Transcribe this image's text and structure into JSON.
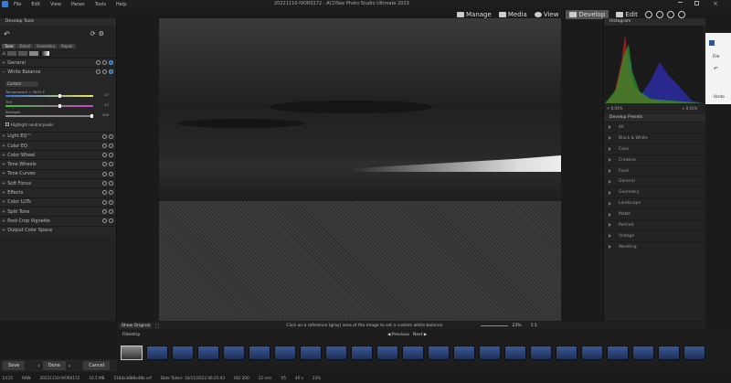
{
  "window": {
    "title": "20221110-IVOR0172 - ACDSee Photo Studio Ultimate 2023"
  },
  "menu": [
    "File",
    "Edit",
    "View",
    "Panes",
    "Tools",
    "Help"
  ],
  "modes": [
    {
      "label": "Manage"
    },
    {
      "label": "Media"
    },
    {
      "label": "View"
    },
    {
      "label": "Develop",
      "active": true
    },
    {
      "label": "Edit"
    }
  ],
  "develop_tools": {
    "title": "Develop Tools",
    "tabs": [
      "Tune",
      "Detail",
      "Geometry",
      "Repair"
    ],
    "white_balance": {
      "label": "White Balance",
      "preset": "Custom",
      "temperature_label": "Temperature = 5623 K",
      "temperature_value": "27",
      "tint_label": "Tint",
      "tint_value": "27",
      "strength_label": "Strength",
      "strength_value": "100",
      "highlight_label": "Highlight neutral pixels"
    },
    "sections": [
      "Light EQ™",
      "Color EQ",
      "Color Wheel",
      "Tone Wheels",
      "Tone Curves",
      "Soft Focus",
      "Effects",
      "Color LUTs",
      "Split Tone",
      "Post-Crop Vignette",
      "Output Color Space"
    ],
    "general_label": "General"
  },
  "histogram": {
    "title": "Histogram",
    "left_val": "< 0.01%",
    "right_val": "< 0.01%"
  },
  "develop_presets": {
    "title": "Develop Presets",
    "items": [
      "All",
      "Black & White",
      "Color",
      "Creative",
      "Food",
      "General",
      "Geometry",
      "Landscape",
      "Matte",
      "Portrait",
      "Vintage",
      "Wedding"
    ]
  },
  "other_app": {
    "menu_file": "File",
    "undo": "Undo"
  },
  "infobar": {
    "show_original": "Show Original",
    "hint": "Click on a reference (gray) area of the image to set a custom white balance.",
    "zoom": "23%",
    "ratio": "1:1"
  },
  "filmstrip": {
    "title": "Filmstrip",
    "previous": "Previous",
    "next": "Next"
  },
  "bottom_buttons": {
    "save": "Save",
    "done": "Done",
    "cancel": "Cancel"
  },
  "status": {
    "count": "1/115",
    "format": "RAW",
    "filename": "20221110-IVOR0172",
    "size": "16.5 MB",
    "dims": "5184x3888x48b orf",
    "date": "Date Taken: 10/11/2022 06:25:43",
    "iso": "ISO 200",
    "focal": "12 mm",
    "aperture": "f/5",
    "shutter": "40 s",
    "zoom": "23%"
  }
}
